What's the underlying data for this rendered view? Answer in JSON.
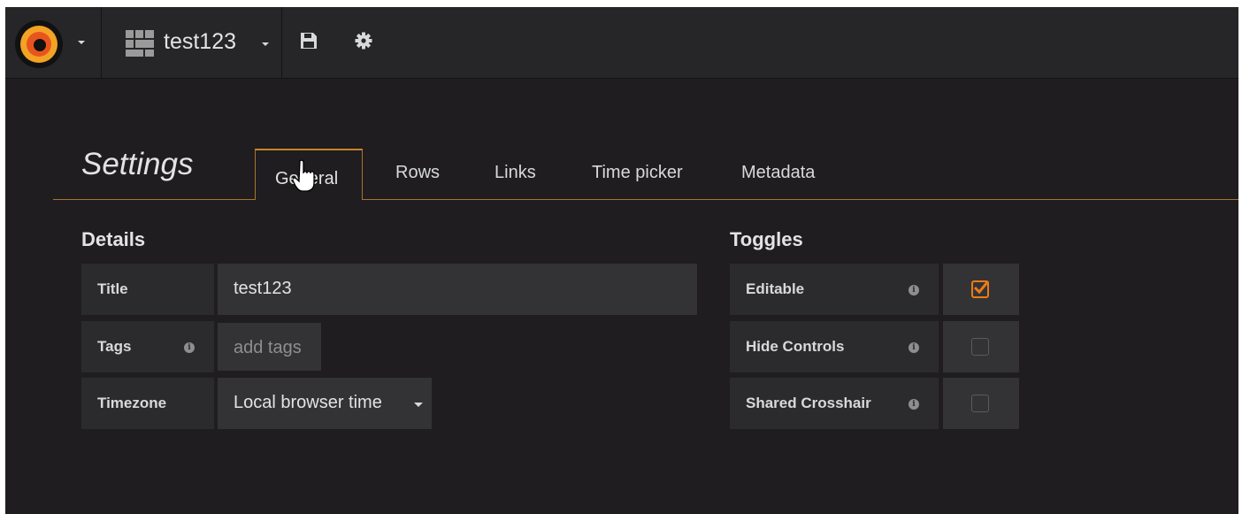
{
  "navbar": {
    "dashboard_title": "test123",
    "icons": [
      "grafana-logo-icon",
      "dashboard-grid-icon",
      "save-icon",
      "gear-icon"
    ]
  },
  "settings": {
    "title": "Settings",
    "tabs": [
      "General",
      "Rows",
      "Links",
      "Time picker",
      "Metadata"
    ],
    "active_tab": "General"
  },
  "details": {
    "heading": "Details",
    "title_label": "Title",
    "title_value": "test123",
    "tags_label": "Tags",
    "tags_placeholder": "add tags",
    "timezone_label": "Timezone",
    "timezone_value": "Local browser time"
  },
  "toggles": {
    "heading": "Toggles",
    "items": [
      {
        "label": "Editable",
        "checked": true
      },
      {
        "label": "Hide Controls",
        "checked": false
      },
      {
        "label": "Shared Crosshair",
        "checked": false
      }
    ]
  },
  "colors": {
    "accent": "#eb7b18",
    "tab_border": "#a8742e",
    "background": "#1f1d1f"
  }
}
